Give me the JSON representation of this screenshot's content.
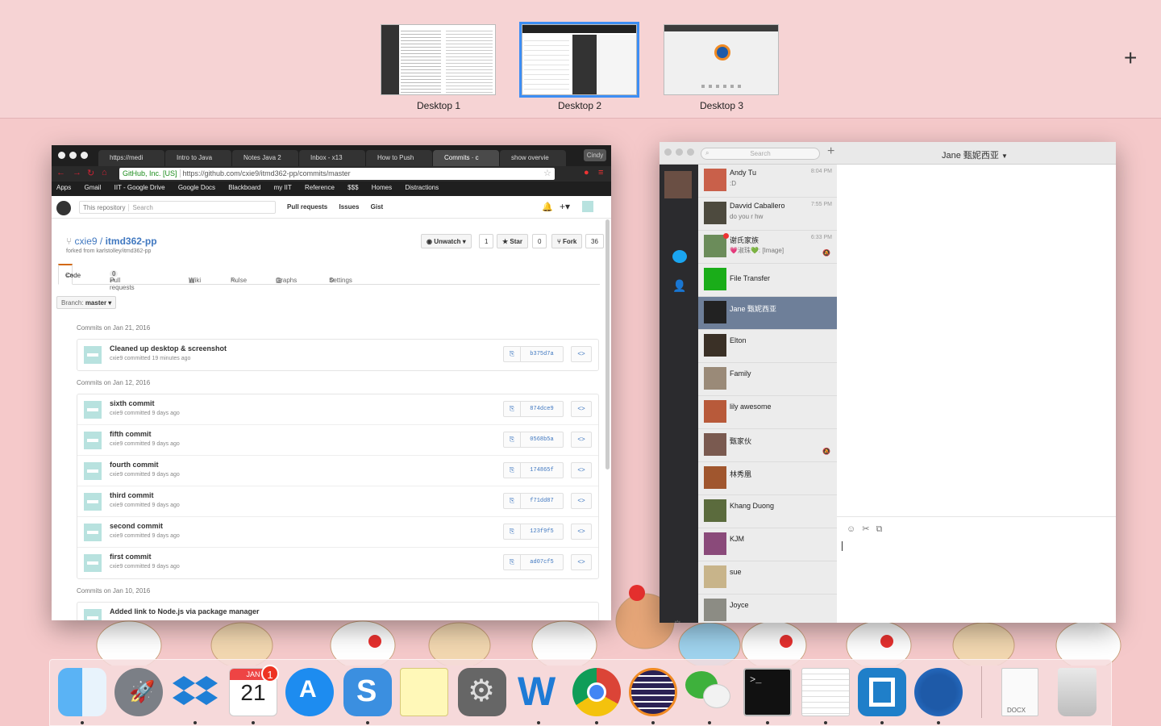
{
  "spaces": {
    "desktops": [
      "Desktop 1",
      "Desktop 2",
      "Desktop 3"
    ],
    "selected": "Desktop 2",
    "add_icon": "plus-icon"
  },
  "chrome": {
    "tabs": [
      "https://medi",
      "Intro to Java",
      "Notes Java 2",
      "Inbox - x13",
      "How to Push",
      "Commits · c",
      "show overvie"
    ],
    "profile": "Cindy",
    "address": {
      "security": "GitHub, Inc. [US]",
      "url": "https://github.com/cxie9/itmd362-pp/commits/master"
    },
    "bookmarks": [
      "Apps",
      "Gmail",
      "IIT - Google Drive",
      "Google Docs",
      "Blackboard",
      "my IIT",
      "Reference",
      "$$$",
      "Homes",
      "Distractions"
    ]
  },
  "github": {
    "search_scope": "This repository",
    "search_placeholder": "Search",
    "nav": [
      "Pull requests",
      "Issues",
      "Gist"
    ],
    "repo_owner": "cxie9",
    "repo_sep": " / ",
    "repo_name": "itmd362-pp",
    "forked_from": "forked from karlstolley/itmd362-pp",
    "unwatch": "Unwatch ▾",
    "unwatch_count": "1",
    "star": "★ Star",
    "star_count": "0",
    "fork": "Fork",
    "fork_count": "36",
    "tabs": [
      "Code",
      "Pull requests",
      "0",
      "Wiki",
      "Pulse",
      "Graphs",
      "Settings"
    ],
    "branch_label": "Branch:",
    "branch": "master ▾",
    "groups": [
      {
        "date": "Commits on Jan 21, 2016",
        "commits": [
          {
            "message": "Cleaned up desktop & screenshot",
            "meta": "cxie9 committed 19 minutes ago",
            "sha": "b375d7a"
          }
        ]
      },
      {
        "date": "Commits on Jan 12, 2016",
        "commits": [
          {
            "message": "sixth commit",
            "meta": "cxie9 committed 9 days ago",
            "sha": "874dce9"
          },
          {
            "message": "fifth commit",
            "meta": "cxie9 committed 9 days ago",
            "sha": "0568b5a"
          },
          {
            "message": "fourth commit",
            "meta": "cxie9 committed 9 days ago",
            "sha": "174865f"
          },
          {
            "message": "third commit",
            "meta": "cxie9 committed 9 days ago",
            "sha": "f71dd87"
          },
          {
            "message": "second commit",
            "meta": "cxie9 committed 9 days ago",
            "sha": "123f9f5"
          },
          {
            "message": "first commit",
            "meta": "cxie9 committed 9 days ago",
            "sha": "ad07cf5"
          }
        ]
      },
      {
        "date": "Commits on Jan 10, 2016",
        "commits": [
          {
            "message": "Added link to Node.js via package manager",
            "meta": "",
            "sha": ""
          }
        ]
      }
    ]
  },
  "wechat": {
    "search_placeholder": "Search",
    "chat_title": "Jane 甄妮西亚",
    "chats": [
      {
        "name": "Andy Tu",
        "preview": ":D",
        "time": "8:04 PM"
      },
      {
        "name": "Davvid Caballero",
        "preview": "do you r hw",
        "time": "7:55 PM"
      },
      {
        "name": "谢氏家族",
        "preview": "💗淑珠💚: [Image]",
        "time": "6:33 PM",
        "muted": true,
        "unread": true
      },
      {
        "name": "File Transfer",
        "preview": "",
        "time": ""
      },
      {
        "name": "Jane 甄妮西亚",
        "preview": "",
        "time": "",
        "selected": true
      },
      {
        "name": "Elton",
        "preview": "",
        "time": ""
      },
      {
        "name": "Family",
        "preview": "",
        "time": ""
      },
      {
        "name": "lily awesome",
        "preview": "",
        "time": ""
      },
      {
        "name": "甄家伙",
        "preview": "",
        "time": "",
        "muted": true
      },
      {
        "name": "林秀凰",
        "preview": "",
        "time": ""
      },
      {
        "name": "Khang Duong",
        "preview": "",
        "time": ""
      },
      {
        "name": "KJM",
        "preview": "",
        "time": ""
      },
      {
        "name": "sue",
        "preview": "",
        "time": ""
      },
      {
        "name": "Joyce",
        "preview": "",
        "time": ""
      }
    ]
  },
  "dock": {
    "calendar_month": "JAN",
    "calendar_day": "21",
    "calendar_badge": "1",
    "docx_label": "DOCX",
    "apps": [
      "finder-icon",
      "launchpad-icon",
      "dropbox-icon",
      "calendar-icon",
      "app-store-icon",
      "scrivener-icon",
      "notes-icon",
      "system-preferences-icon",
      "word-icon",
      "chrome-icon",
      "eclipse-icon",
      "wechat-icon",
      "terminal-icon",
      "textedit-icon",
      "brackets-icon",
      "firefox-icon"
    ]
  }
}
